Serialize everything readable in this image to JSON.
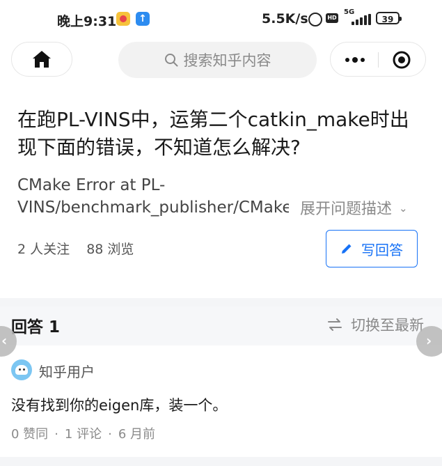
{
  "status_bar": {
    "time": "晚上9:31",
    "net_speed": "5.5K/s",
    "hd_label": "HD",
    "network_type": "5G",
    "battery": "39",
    "app_icon_2_glyph": "↑"
  },
  "nav": {
    "search_placeholder": "搜索知乎内容"
  },
  "question": {
    "title": "在跑PL-VINS中，运第二个catkin_make时出现下面的错误，不知道怎么解决?",
    "desc_line1": "CMake Error at PL-",
    "desc_line2": "VINS/benchmark_publisher/CMake",
    "expand_label": "展开问题描述",
    "expand_chevron": "⌄",
    "followers_text": "2 人关注",
    "views_text": "88 浏览",
    "write_answer_label": "写回答"
  },
  "answers": {
    "header_label": "回答",
    "count": "1",
    "switch_label": "切换至最新",
    "items": [
      {
        "author": "知乎用户",
        "content": "没有找到你的eigen库，装一个。",
        "likes": "0 赞同",
        "comments": "1 评论",
        "time": "6 月前"
      }
    ]
  },
  "side_buttons": {
    "left_glyph": "‹",
    "right_glyph": "›"
  },
  "colors": {
    "accent": "#1772f6",
    "muted": "#8a8a8a",
    "band": "#f4f5f7"
  }
}
